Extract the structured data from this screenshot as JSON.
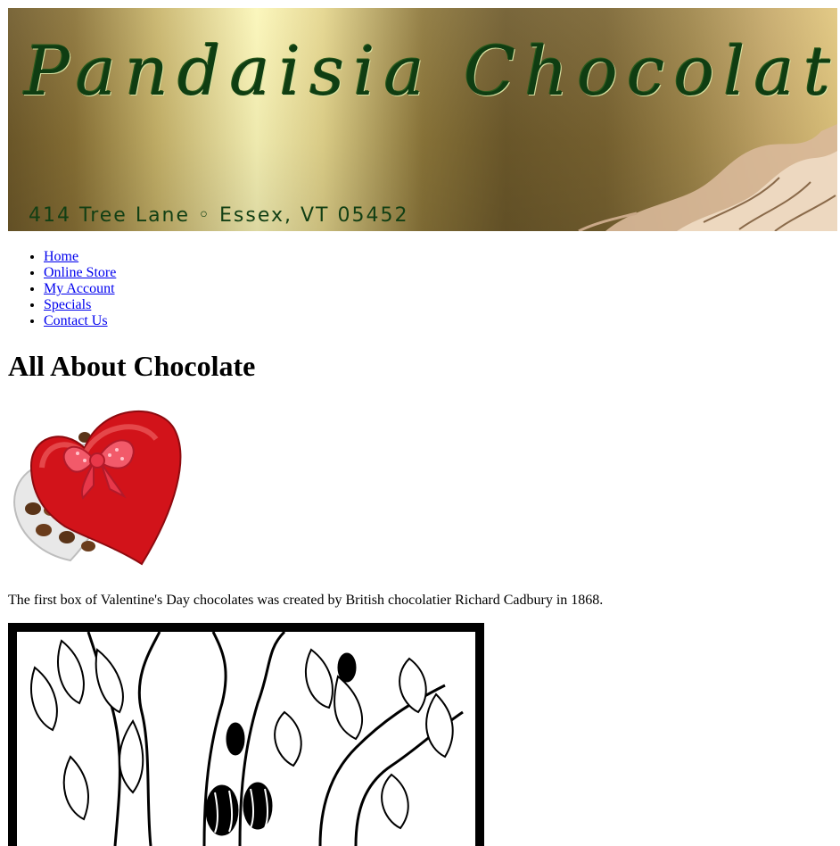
{
  "banner": {
    "title": "Pandaisia Chocolates",
    "address": "414 Tree Lane ◦ Essex, VT 05452"
  },
  "nav": {
    "items": [
      {
        "label": "Home"
      },
      {
        "label": "Online Store"
      },
      {
        "label": "My Account"
      },
      {
        "label": "Specials"
      },
      {
        "label": "Contact Us"
      }
    ]
  },
  "main": {
    "heading": "All About Chocolate",
    "fact": "The first box of Valentine's Day chocolates was created by British chocolatier Richard Cadbury in 1868."
  },
  "colors": {
    "banner_text": "#0f3d12",
    "link": "#0000ee",
    "heart_red": "#d2131a"
  }
}
